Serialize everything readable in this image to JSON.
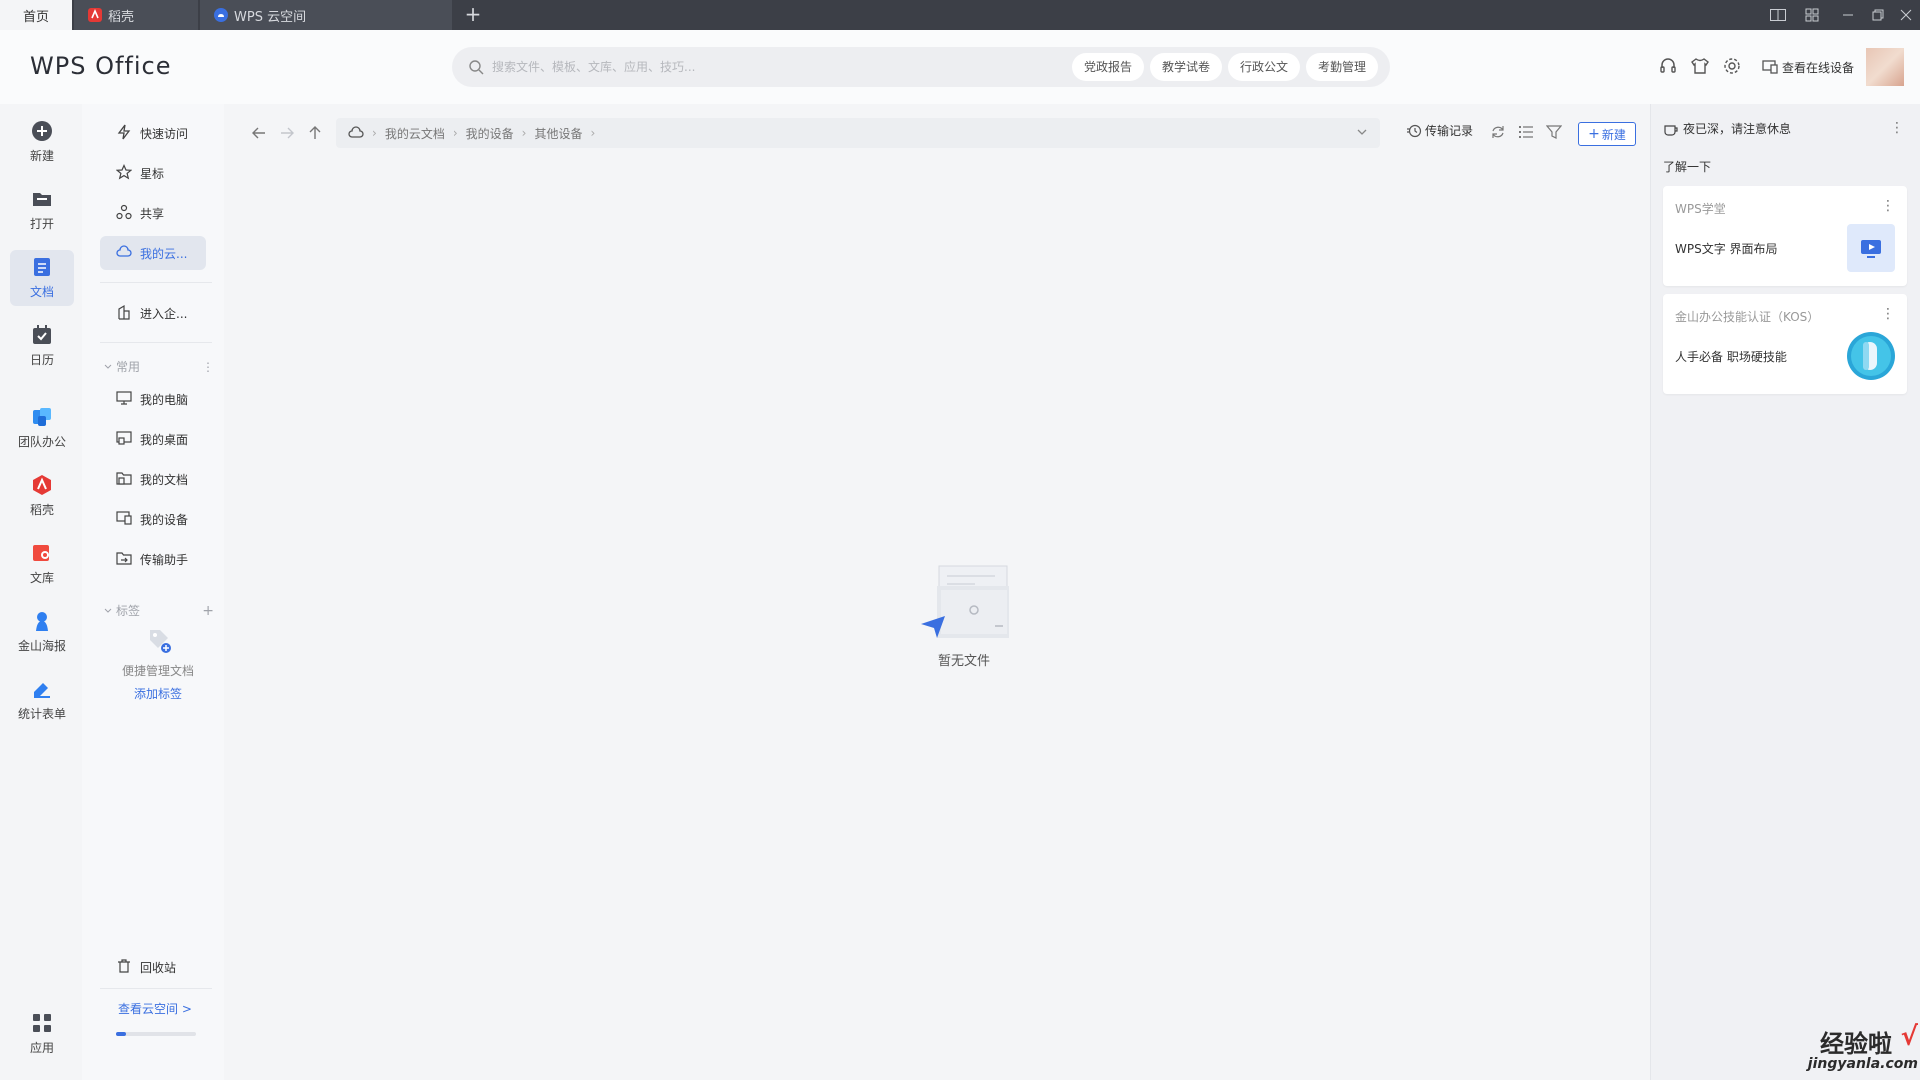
{
  "tabs": [
    {
      "label": "首页",
      "icon": "home"
    },
    {
      "label": "稻壳",
      "icon": "docer-icon"
    },
    {
      "label": "WPS 云空间",
      "icon": "cloud-icon"
    }
  ],
  "header": {
    "logo": "WPS Office",
    "search_placeholder": "搜索文件、模板、文库、应用、技巧...",
    "chips": [
      "党政报告",
      "教学试卷",
      "行政公文",
      "考勤管理"
    ],
    "devices_label": "查看在线设备"
  },
  "leftnav": [
    {
      "label": "新建",
      "icon": "plus-circle-icon"
    },
    {
      "label": "打开",
      "icon": "folder-open-icon"
    },
    {
      "label": "文档",
      "icon": "document-icon",
      "active": true
    },
    {
      "label": "日历",
      "icon": "calendar-icon"
    },
    {
      "label": "团队办公",
      "icon": "team-icon"
    },
    {
      "label": "稻壳",
      "icon": "docer-icon"
    },
    {
      "label": "文库",
      "icon": "library-icon"
    },
    {
      "label": "金山海报",
      "icon": "poster-icon"
    },
    {
      "label": "统计表单",
      "icon": "form-icon"
    },
    {
      "label": "应用",
      "icon": "apps-grid-icon"
    }
  ],
  "folder": {
    "items": [
      {
        "label": "快速访问",
        "icon": "lightning-icon"
      },
      {
        "label": "星标",
        "icon": "star-icon"
      },
      {
        "label": "共享",
        "icon": "share-icon"
      },
      {
        "label": "我的云...",
        "icon": "cloud-icon",
        "active": true
      },
      {
        "label": "进入企...",
        "icon": "enterprise-icon"
      }
    ],
    "common_header": "常用",
    "common": [
      {
        "label": "我的电脑",
        "icon": "computer-icon"
      },
      {
        "label": "我的桌面",
        "icon": "desktop-icon"
      },
      {
        "label": "我的文档",
        "icon": "my-docs-icon"
      },
      {
        "label": "我的设备",
        "icon": "device-icon"
      },
      {
        "label": "传输助手",
        "icon": "transfer-icon"
      }
    ],
    "tags_header": "标签",
    "tag_tip": "便捷管理文档",
    "tag_link": "添加标签",
    "trash": "回收站",
    "view_cloud": "查看云空间 >",
    "storage_used": 0.12
  },
  "main": {
    "breadcrumb": [
      "我的云文档",
      "我的设备",
      "其他设备"
    ],
    "transfer_record": "传输记录",
    "new_label": "新建",
    "empty_text": "暂无文件"
  },
  "right": {
    "greeting": "夜已深，请注意休息",
    "learn": "了解一下",
    "cards": [
      {
        "header": "WPS学堂",
        "body": "WPS文字 界面布局"
      },
      {
        "header": "金山办公技能认证（KOS）",
        "body": "人手必备 职场硬技能"
      }
    ]
  },
  "watermark": {
    "text": "经验啦",
    "check": "√",
    "url": "jingyanla.com"
  },
  "colors": {
    "accent": "#3a6fe0",
    "titlebar": "#3c3f47",
    "background": "#f4f5f7"
  }
}
